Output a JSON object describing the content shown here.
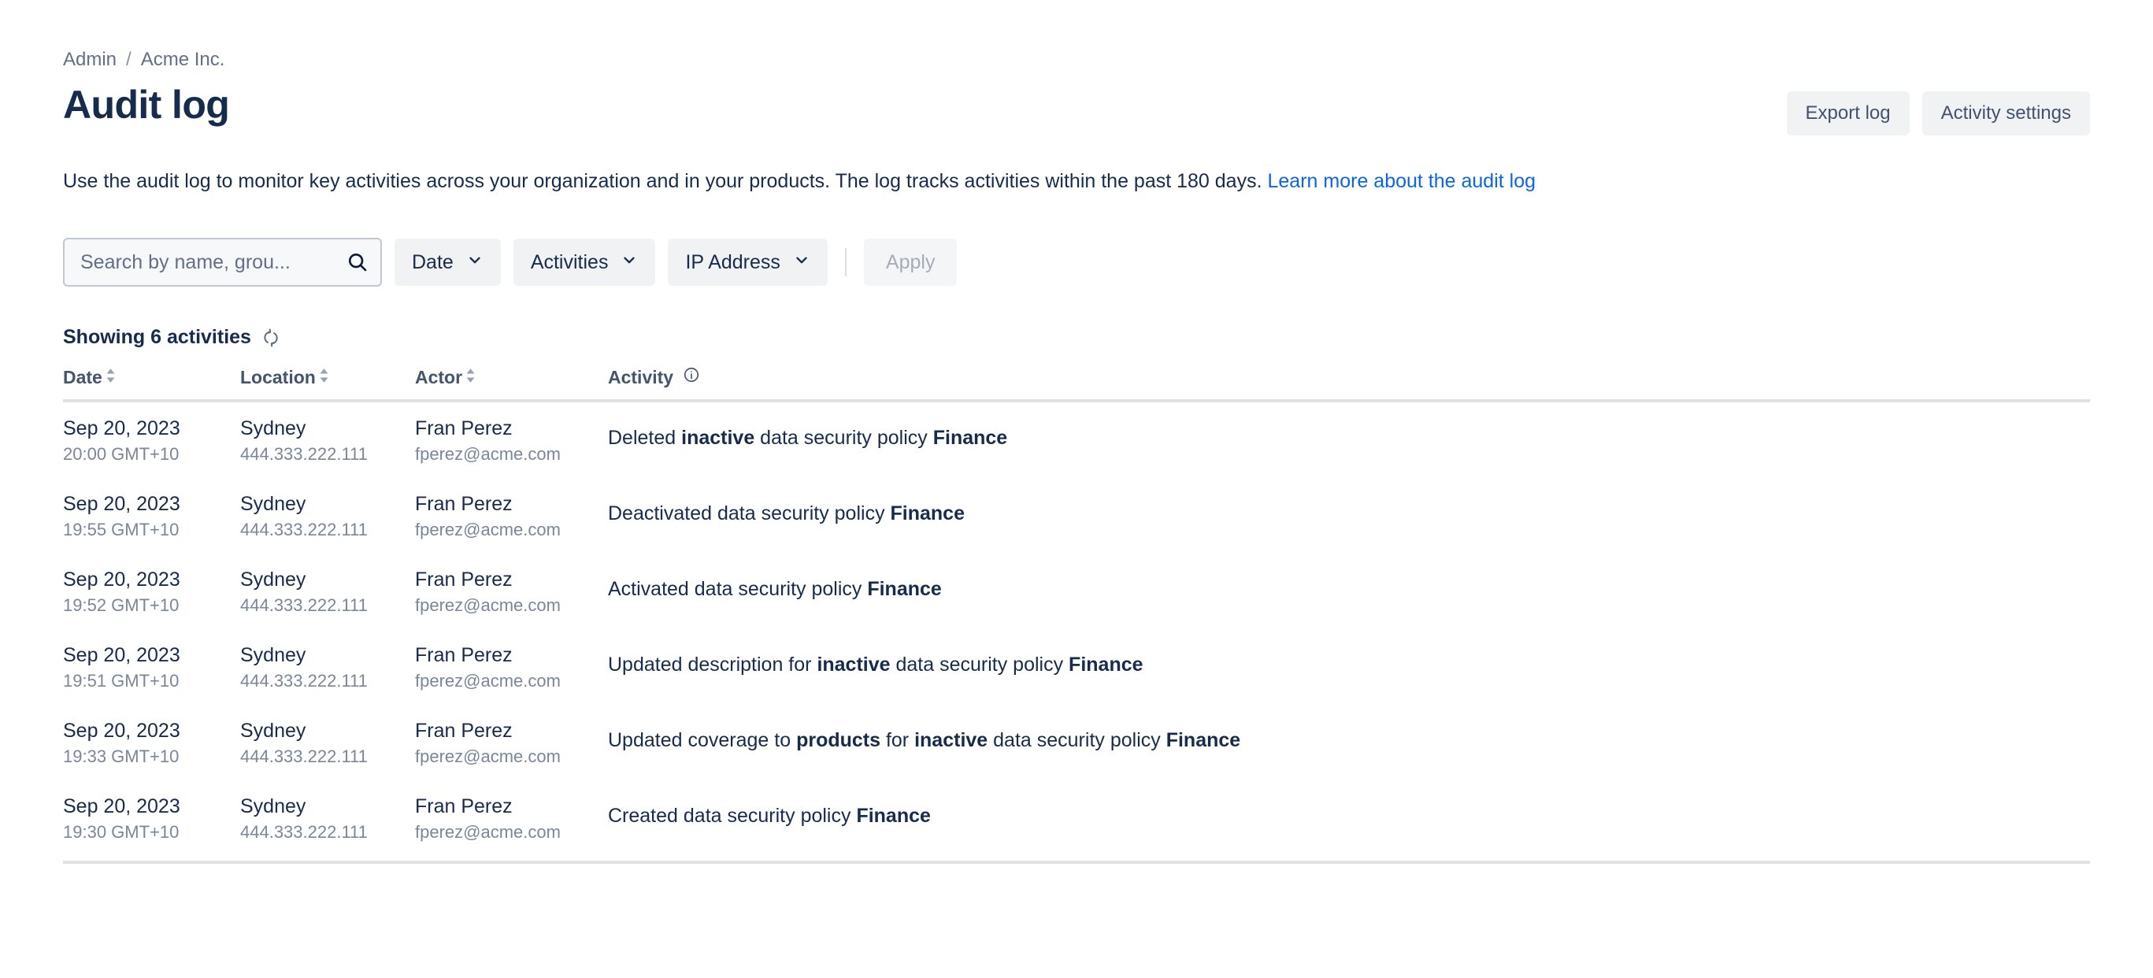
{
  "breadcrumb": {
    "items": [
      "Admin",
      "Acme Inc."
    ],
    "separator": "/"
  },
  "header": {
    "title": "Audit log",
    "actions": [
      {
        "label": "Export log",
        "name": "export-log-button"
      },
      {
        "label": "Activity settings",
        "name": "activity-settings-button"
      }
    ]
  },
  "description": {
    "text": "Use the audit log to monitor key activities across your organization and in your products. The log tracks activities within the past 180 days.",
    "link_text": "Learn more about the audit log"
  },
  "filters": {
    "search": {
      "placeholder": "Search by name, grou...",
      "value": ""
    },
    "date": {
      "label": "Date"
    },
    "activities": {
      "label": "Activities"
    },
    "ip_address": {
      "label": "IP Address"
    },
    "apply": {
      "label": "Apply",
      "disabled": true
    }
  },
  "results": {
    "showing_label": "Showing 6 activities",
    "count": 6
  },
  "table": {
    "columns": [
      {
        "label": "Date",
        "sortable": true
      },
      {
        "label": "Location",
        "sortable": true
      },
      {
        "label": "Actor",
        "sortable": true
      },
      {
        "label": "Activity",
        "sortable": false,
        "info": true
      }
    ],
    "rows": [
      {
        "date": "Sep 20, 2023",
        "time": "20:00 GMT+10",
        "location": "Sydney",
        "ip": "444.333.222.111",
        "actor": "Fran Perez",
        "email": "fperez@acme.com",
        "activity_parts": [
          {
            "text": "Deleted ",
            "bold": false
          },
          {
            "text": "inactive",
            "bold": true
          },
          {
            "text": " data security policy ",
            "bold": false
          },
          {
            "text": "Finance",
            "bold": true
          }
        ]
      },
      {
        "date": "Sep 20, 2023",
        "time": "19:55 GMT+10",
        "location": "Sydney",
        "ip": "444.333.222.111",
        "actor": "Fran Perez",
        "email": "fperez@acme.com",
        "activity_parts": [
          {
            "text": "Deactivated data security policy ",
            "bold": false
          },
          {
            "text": "Finance",
            "bold": true
          }
        ]
      },
      {
        "date": "Sep 20, 2023",
        "time": "19:52 GMT+10",
        "location": "Sydney",
        "ip": "444.333.222.111",
        "actor": "Fran Perez",
        "email": "fperez@acme.com",
        "activity_parts": [
          {
            "text": "Activated data security policy ",
            "bold": false
          },
          {
            "text": "Finance",
            "bold": true
          }
        ]
      },
      {
        "date": "Sep 20, 2023",
        "time": "19:51 GMT+10",
        "location": "Sydney",
        "ip": "444.333.222.111",
        "actor": "Fran Perez",
        "email": "fperez@acme.com",
        "activity_parts": [
          {
            "text": "Updated description for ",
            "bold": false
          },
          {
            "text": "inactive",
            "bold": true
          },
          {
            "text": " data security policy ",
            "bold": false
          },
          {
            "text": "Finance",
            "bold": true
          }
        ]
      },
      {
        "date": "Sep 20, 2023",
        "time": "19:33 GMT+10",
        "location": "Sydney",
        "ip": "444.333.222.111",
        "actor": "Fran Perez",
        "email": "fperez@acme.com",
        "activity_parts": [
          {
            "text": "Updated coverage to ",
            "bold": false
          },
          {
            "text": "products",
            "bold": true
          },
          {
            "text": " for ",
            "bold": false
          },
          {
            "text": "inactive",
            "bold": true
          },
          {
            "text": " data security policy ",
            "bold": false
          },
          {
            "text": "Finance",
            "bold": true
          }
        ]
      },
      {
        "date": "Sep 20, 2023",
        "time": "19:30 GMT+10",
        "location": "Sydney",
        "ip": "444.333.222.111",
        "actor": "Fran Perez",
        "email": "fperez@acme.com",
        "activity_parts": [
          {
            "text": "Created data security policy ",
            "bold": false
          },
          {
            "text": "Finance",
            "bold": true
          }
        ]
      }
    ]
  },
  "colors": {
    "link": "#0C66E4",
    "text": "#172B4D",
    "muted": "#7A869A",
    "subtle_bg": "#F1F2F4",
    "border": "#DFE1E6"
  }
}
